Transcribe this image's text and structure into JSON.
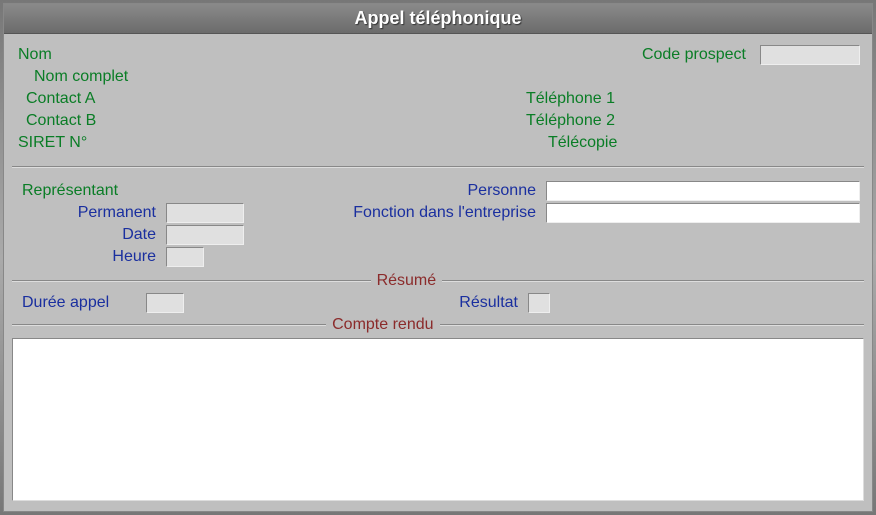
{
  "window": {
    "title": "Appel téléphonique"
  },
  "header": {
    "nom": "Nom",
    "nom_complet": "Nom complet",
    "contact_a": "Contact A",
    "contact_b": "Contact B",
    "siret": "SIRET N°",
    "code_prospect": "Code prospect",
    "code_prospect_value": "",
    "telephone1": "Téléphone 1",
    "telephone2": "Téléphone 2",
    "telecopie": "Télécopie"
  },
  "mid": {
    "representant": "Représentant",
    "permanent": "Permanent",
    "permanent_value": "",
    "date": "Date",
    "date_value": "",
    "heure": "Heure",
    "heure_value": "",
    "personne": "Personne",
    "personne_value": "",
    "fonction": "Fonction dans l'entreprise",
    "fonction_value": ""
  },
  "resume": {
    "legend": "Résumé",
    "duree_appel": "Durée appel",
    "duree_appel_value": "",
    "resultat": "Résultat",
    "resultat_value": ""
  },
  "compte_rendu": {
    "legend": "Compte rendu",
    "value": ""
  }
}
